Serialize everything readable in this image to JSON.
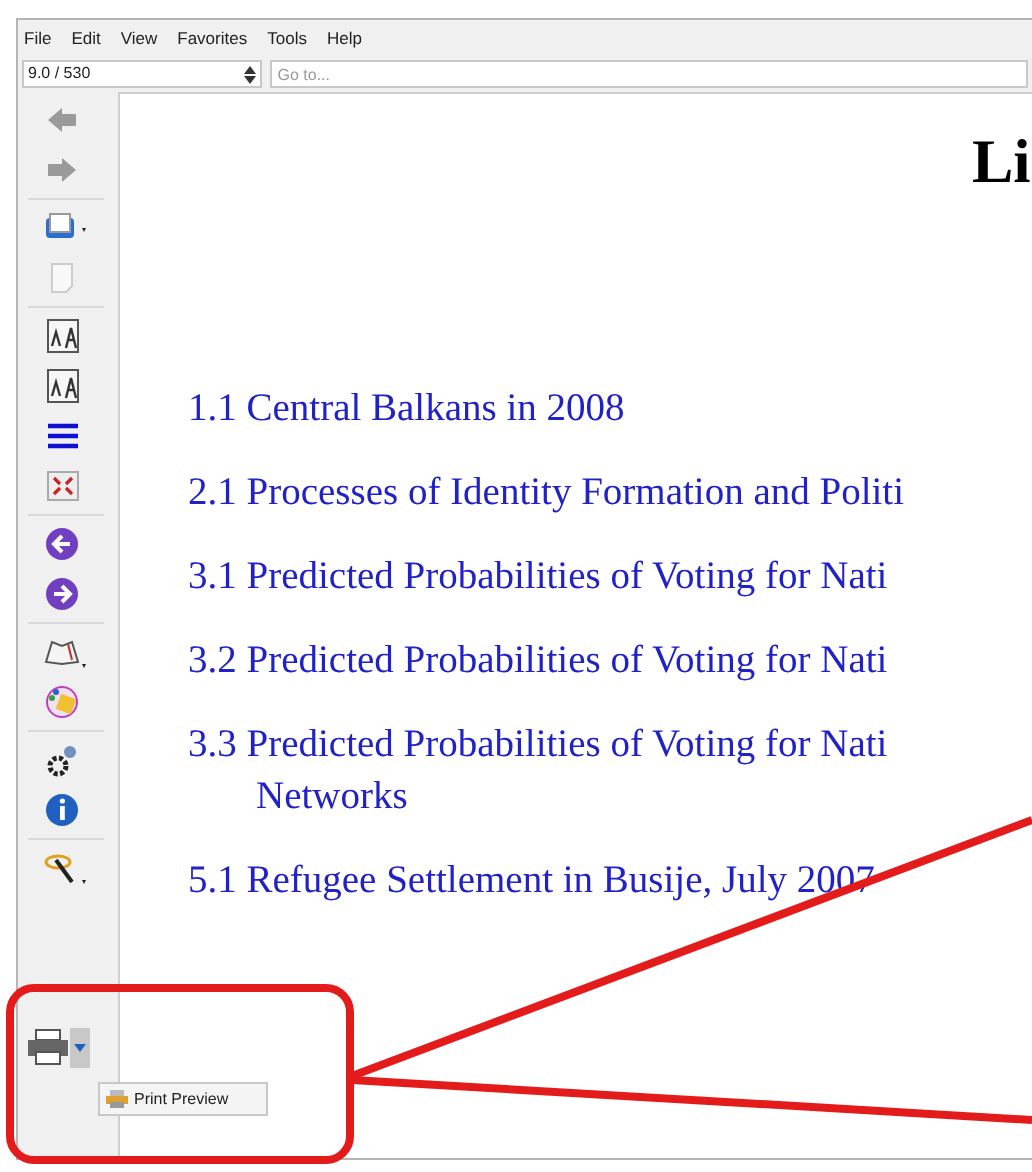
{
  "menu_bar": [
    "File",
    "Edit",
    "View",
    "Favorites",
    "Tools",
    "Help"
  ],
  "page_field": {
    "value": "9.0 / 530"
  },
  "goto_field": {
    "placeholder": "Go to..."
  },
  "document": {
    "title": "Li",
    "entries": [
      {
        "lines": [
          "1.1 Central Balkans in 2008"
        ]
      },
      {
        "lines": [
          "2.1 Processes of Identity Formation and Politi"
        ]
      },
      {
        "lines": [
          "3.1 Predicted Probabilities of Voting for Nati"
        ]
      },
      {
        "lines": [
          "3.2 Predicted Probabilities of Voting for Nati"
        ]
      },
      {
        "lines": [
          "3.3 Predicted Probabilities of Voting for Nati",
          "Networks"
        ]
      },
      {
        "lines": [
          "5.1 Refugee Settlement in Busije, July 2007"
        ]
      }
    ]
  },
  "print_menu": {
    "item": "Print Preview"
  }
}
